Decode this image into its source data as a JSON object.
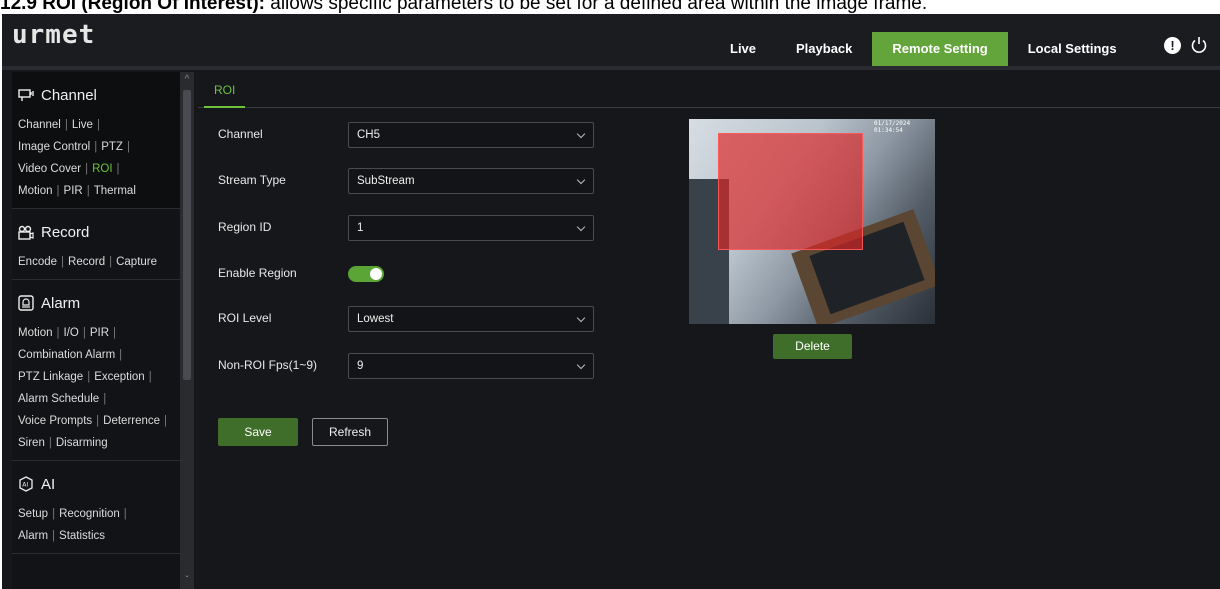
{
  "doc_caption": {
    "bold_part": "12.9 ROI (Region Of Interest):",
    "rest": " allows specific parameters to be set for a defined area within the image frame."
  },
  "header": {
    "logo": "urmet",
    "nav": [
      {
        "label": "Live",
        "active": false
      },
      {
        "label": "Playback",
        "active": false
      },
      {
        "label": "Remote Setting",
        "active": true
      },
      {
        "label": "Local Settings",
        "active": false
      }
    ],
    "alert_glyph": "!"
  },
  "sidebar": {
    "sections": [
      {
        "title": "Channel",
        "icon": "channel-icon",
        "lines": [
          [
            "Channel",
            "Live"
          ],
          [
            "Image Control",
            "PTZ"
          ],
          [
            "Video Cover",
            "ROI"
          ],
          [
            "Motion",
            "PIR",
            "Thermal"
          ]
        ],
        "active_link": "ROI"
      },
      {
        "title": "Record",
        "icon": "record-icon",
        "lines": [
          [
            "Encode",
            "Record",
            "Capture"
          ]
        ]
      },
      {
        "title": "Alarm",
        "icon": "alarm-icon",
        "lines": [
          [
            "Motion",
            "I/O",
            "PIR"
          ],
          [
            "Combination Alarm"
          ],
          [
            "PTZ Linkage",
            "Exception"
          ],
          [
            "Alarm Schedule"
          ],
          [
            "Voice Prompts",
            "Deterrence"
          ],
          [
            "Siren",
            "Disarming"
          ]
        ]
      },
      {
        "title": "AI",
        "icon": "ai-icon",
        "lines": [
          [
            "Setup",
            "Recognition"
          ],
          [
            "Alarm",
            "Statistics"
          ]
        ]
      }
    ]
  },
  "main": {
    "tab": "ROI",
    "form": {
      "channel": {
        "label": "Channel",
        "value": "CH5"
      },
      "stream_type": {
        "label": "Stream Type",
        "value": "SubStream"
      },
      "region_id": {
        "label": "Region ID",
        "value": "1"
      },
      "enable_region": {
        "label": "Enable Region",
        "enabled": true
      },
      "roi_level": {
        "label": "ROI Level",
        "value": "Lowest"
      },
      "non_roi_fps": {
        "label": "Non-ROI Fps(1~9)",
        "value": "9"
      }
    },
    "save_label": "Save",
    "refresh_label": "Refresh",
    "delete_label": "Delete",
    "preview_timestamp": "01/17/2024 01:34:54"
  },
  "colors": {
    "accent": "#63a53a",
    "active_link": "#6cc33c",
    "roi_overlay": "#dc2828"
  }
}
